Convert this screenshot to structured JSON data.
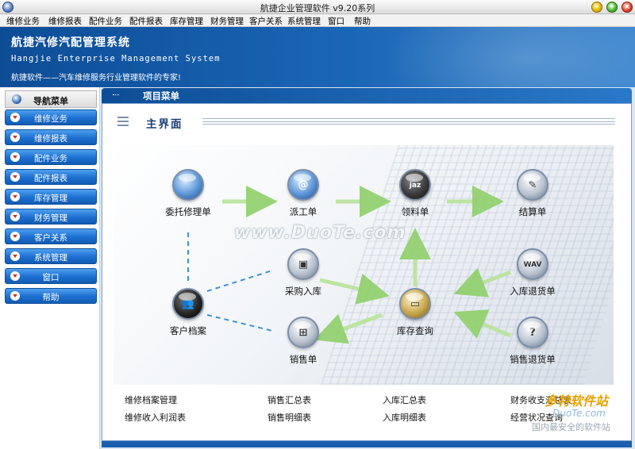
{
  "window": {
    "title": "航捷企业管理软件 v9.20系列"
  },
  "menu": [
    "维修业务",
    "维修报表",
    "配件业务",
    "配件报表",
    "库存管理",
    "财务管理",
    "客户关系",
    "系统管理",
    "窗口",
    "帮助"
  ],
  "header": {
    "title": "航捷汽修汽配管理系统",
    "subtitle": "Hangjie Enterprise Management System",
    "tagline": "航捷软件——汽车维修服务行业管理软件的专家!"
  },
  "sidebar": {
    "title": "导航菜单",
    "items": [
      "维修业务",
      "维修报表",
      "配件业务",
      "配件报表",
      "库存管理",
      "财务管理",
      "客户关系",
      "系统管理",
      "窗口",
      "帮助"
    ]
  },
  "main": {
    "panel_title": "项目菜单",
    "section_title": "主界面",
    "watermark": "www.DuoTe.com",
    "nodes": {
      "entrust": "委托修理单",
      "dispatch": "派工单",
      "material": "领料单",
      "settle": "结算单",
      "purchase": "采购入库",
      "stock_return": "入库退货单",
      "customer": "客户档案",
      "inventory": "库存查询",
      "sales": "销售单",
      "sales_return": "销售退货单"
    },
    "links": [
      [
        "维修档案管理",
        "销售汇总表",
        "入库汇总表",
        "财务收支汇总表"
      ],
      [
        "维修收入利润表",
        "销售明细表",
        "入库明细表",
        "经营状况查询"
      ]
    ],
    "corner": {
      "logo": "多特软件站",
      "site": "DuoTe.com",
      "text": "国内最安全的软件站"
    }
  },
  "colors": {
    "header_blue": "#0d4d96",
    "sidebar_button": "#1c6fd1",
    "arrow_green": "#8fd06a",
    "dashed_link": "#3d93d3"
  }
}
